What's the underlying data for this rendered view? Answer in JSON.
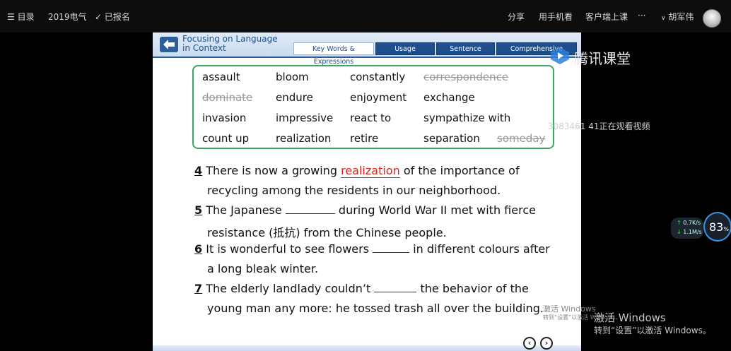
{
  "topbar": {
    "menu_label": "目录",
    "course_name": "2019电气",
    "registered_label": "已报名",
    "share_label": "分享",
    "phone_label": "用手机看",
    "client_label": "客户端上课",
    "more_label": "···",
    "user_name": "胡军伟"
  },
  "slide": {
    "header_title_line1": "Focusing on Language",
    "header_title_line2": "in Context",
    "tabs": [
      {
        "label": "Key Words & Expressions",
        "active": true
      },
      {
        "label": "Usage",
        "active": false
      },
      {
        "label": "Sentence Patterns",
        "active": false
      },
      {
        "label": "Comprehensive Practice",
        "active": false
      }
    ],
    "word_bank": [
      [
        "assault",
        "bloom",
        "constantly",
        "correspondence"
      ],
      [
        "dominate",
        "endure",
        "enjoyment",
        "exchange"
      ],
      [
        "invasion",
        "impressive",
        "react to",
        "sympathize with"
      ],
      [
        "count up",
        "realization",
        "retire",
        "separation",
        "someday"
      ]
    ],
    "struck_words": [
      "correspondence",
      "dominate",
      "someday"
    ],
    "questions": [
      {
        "num": "4",
        "before": "There is now a growing",
        "answer": "realization",
        "after": " of the importance of",
        "line2": "recycling among the residents in our neighborhood."
      },
      {
        "num": "5",
        "before": "The Japanese",
        "answer": "",
        "after": "during World War II met with fierce",
        "line2": "resistance (抵抗) from the Chinese people."
      },
      {
        "num": "6",
        "before": "It is wonderful to see flowers",
        "answer": "",
        "after": "in different colours after",
        "line2": "a long bleak winter."
      },
      {
        "num": "7",
        "before": "The elderly landlady couldn’t",
        "answer": "",
        "after": "the behavior of the",
        "line2": "young man any more: he tossed trash all over the building."
      }
    ],
    "nav_prev": "‹",
    "nav_next": "›"
  },
  "overlay": {
    "brand": "腾讯课堂",
    "viewer_text": "3083461 41正在观看视频",
    "upload_speed": "0.7K/s",
    "download_speed": "1.1M/s",
    "gauge_value": "83",
    "gauge_unit": "%",
    "activate_small_1": "激活 Windows",
    "activate_small_2": "转到“设置”以激活 Windows。",
    "activate_big_1": "激活 Windows",
    "activate_big_2": "转到“设置”以激活 Windows。"
  },
  "colors": {
    "answer_red": "#d9241b",
    "word_box_green": "#3aa864",
    "tab_blue": "#1f4e8c"
  }
}
